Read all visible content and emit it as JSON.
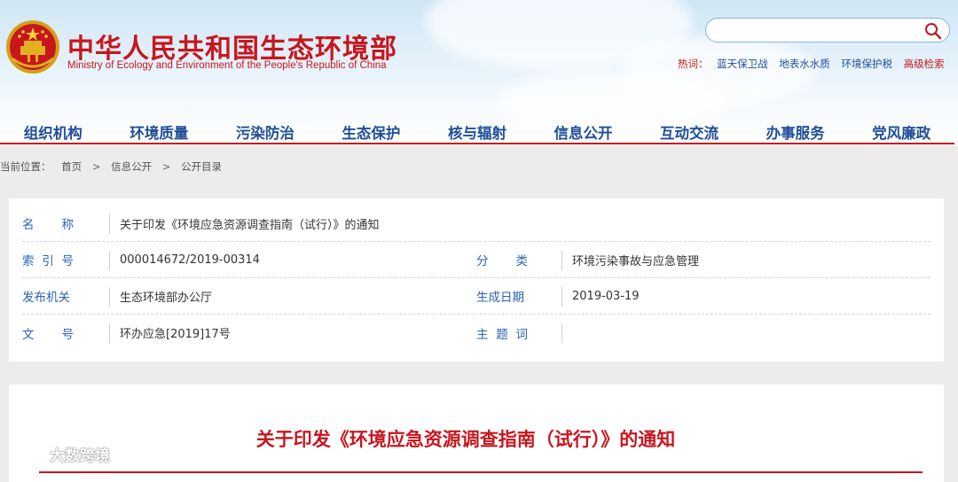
{
  "header": {
    "title_cn": "中华人民共和国生态环境部",
    "title_en": "Ministry of Ecology and Environment of the People's Republic of China",
    "search": {
      "value": "",
      "placeholder": ""
    },
    "hotwords": {
      "label": "热词：",
      "items": [
        "蓝天保卫战",
        "地表水水质",
        "环境保护税"
      ],
      "advanced_search": "高级检索"
    },
    "colors": {
      "brand_red": "#c8161d",
      "nav_blue": "#1f4f97"
    }
  },
  "nav": {
    "items": [
      "组织机构",
      "环境质量",
      "污染防治",
      "生态保护",
      "核与辐射",
      "信息公开",
      "互动交流",
      "办事服务",
      "党风廉政"
    ]
  },
  "breadcrumb": {
    "prefix": "当前位置：",
    "items": [
      "首页",
      "信息公开",
      "公开目录"
    ],
    "separator": ">"
  },
  "meta": {
    "name": {
      "label": [
        "名",
        "称"
      ],
      "value": "关于印发《环境应急资源调查指南（试行）》的通知"
    },
    "index": {
      "label": [
        "索",
        "引",
        "号"
      ],
      "value": "000014672/2019-00314"
    },
    "category": {
      "label": [
        "分",
        "类"
      ],
      "value": "环境污染事故与应急管理"
    },
    "issuer": {
      "label": "发布机关",
      "value": "生态环境部办公厅"
    },
    "date": {
      "label": "生成日期",
      "value": "2019-03-19"
    },
    "doc_no": {
      "label": [
        "文",
        "号"
      ],
      "value": "环办应急[2019]17号"
    },
    "subject": {
      "label": [
        "主",
        "题",
        "词"
      ],
      "value": ""
    }
  },
  "article": {
    "title": "关于印发《环境应急资源调查指南（试行）》的通知"
  },
  "watermark": {
    "text": "大数跨境"
  }
}
